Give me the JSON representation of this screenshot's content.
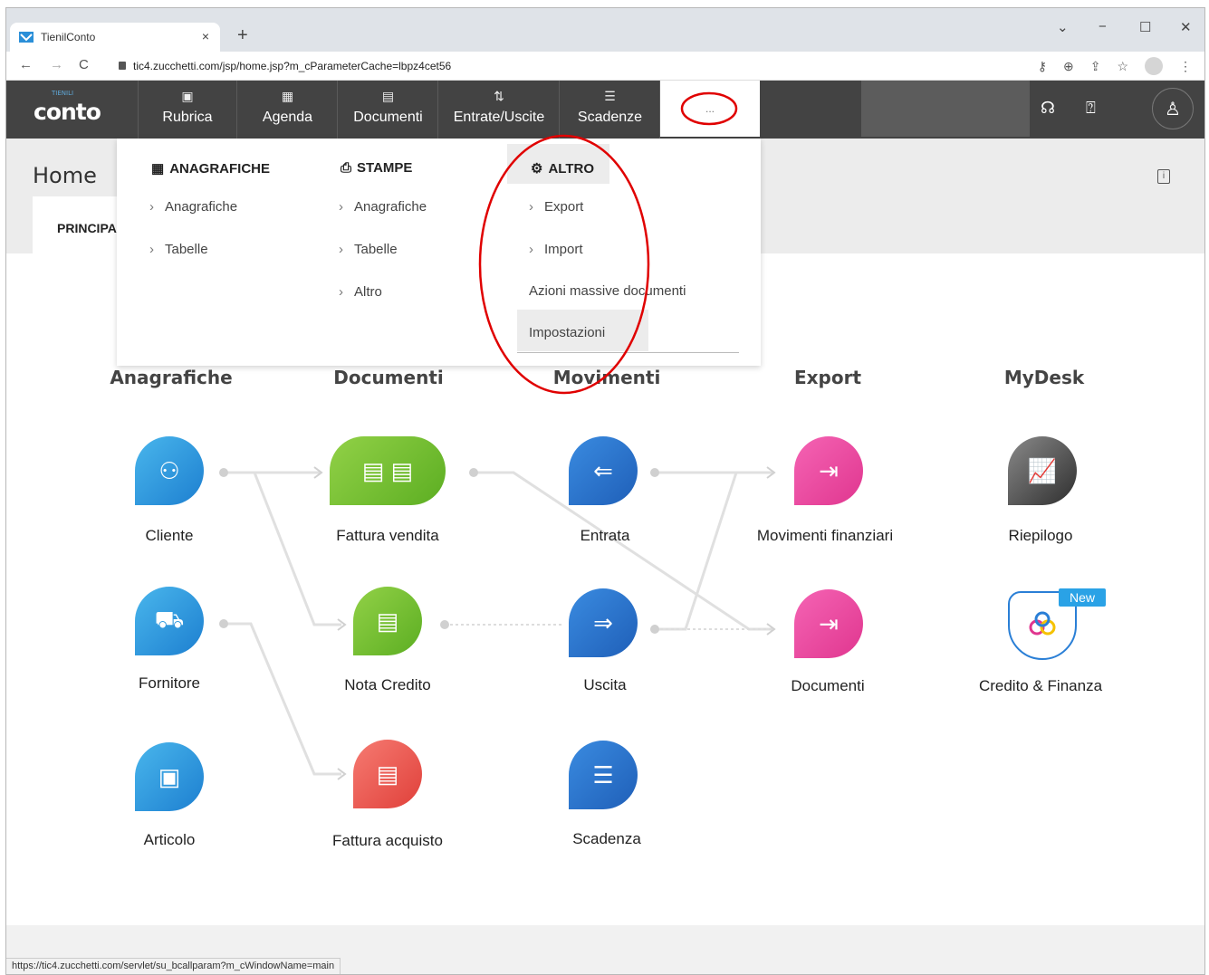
{
  "browser": {
    "tab_title": "TienilConto",
    "tab_close": "×",
    "new_tab": "+",
    "window_controls": {
      "minimize": "−",
      "maximize": "☐",
      "close": "✕",
      "dropdown": "⌄"
    },
    "url": "tic4.zucchetti.com/jsp/home.jsp?m_cParameterCache=lbpz4cet56",
    "status_url": "https://tic4.zucchetti.com/servlet/su_bcallparam?m_cWindowName=main"
  },
  "app": {
    "logo_text": "conto",
    "logo_small": "TIENILI",
    "nav": [
      {
        "label": "Rubrica",
        "icon": "rubrica-icon"
      },
      {
        "label": "Agenda",
        "icon": "calendar-icon"
      },
      {
        "label": "Documenti",
        "icon": "document-icon"
      },
      {
        "label": "Entrate/Uscite",
        "icon": "updown-arrows-icon"
      },
      {
        "label": "Scadenze",
        "icon": "checklist-icon"
      }
    ],
    "more_label": "..."
  },
  "page": {
    "title": "Home",
    "tab_label": "PRINCIPALE"
  },
  "dropdown": {
    "col1": {
      "title": "ANAGRAFICHE",
      "items": [
        "Anagrafiche",
        "Tabelle"
      ]
    },
    "col2": {
      "title": "STAMPE",
      "items": [
        "Anagrafiche",
        "Tabelle",
        "Altro"
      ]
    },
    "col3": {
      "title": "ALTRO",
      "items": [
        "Export",
        "Import"
      ],
      "plain_items": [
        "Azioni massive documenti",
        "Impostazioni"
      ]
    }
  },
  "columns": {
    "anagrafiche": "Anagrafiche",
    "documenti": "Documenti",
    "movimenti": "Movimenti",
    "export": "Export",
    "mydesk": "MyDesk"
  },
  "nodes": {
    "cliente": "Cliente",
    "fornitore": "Fornitore",
    "articolo": "Articolo",
    "fattura_vendita": "Fattura vendita",
    "nota_credito": "Nota Credito",
    "fattura_acquisto": "Fattura acquisto",
    "entrata": "Entrata",
    "uscita": "Uscita",
    "scadenza": "Scadenza",
    "movimenti_finanziari": "Movimenti finanziari",
    "documenti": "Documenti",
    "riepilogo": "Riepilogo",
    "credito_finanza": "Credito & Finanza",
    "new_badge": "New"
  },
  "colors": {
    "annotation_red": "#e00000",
    "nav_bg": "#434343"
  }
}
